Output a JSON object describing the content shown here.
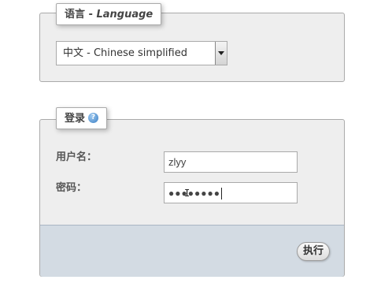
{
  "language_section": {
    "legend_cn": "语言",
    "legend_sep": " - ",
    "legend_en": "Language",
    "select_value": "中文 - Chinese simplified"
  },
  "login_section": {
    "legend": "登录",
    "help_icon": "?",
    "username_label": "用户名：",
    "password_label": "密码：",
    "username_value": "zlyy",
    "password_masked": "●●●●●●●●",
    "submit_label": "执行"
  },
  "colors": {
    "panel_bg": "#eeeeee",
    "footer_bg": "#d3dbe3",
    "border": "#aaaaaa"
  }
}
